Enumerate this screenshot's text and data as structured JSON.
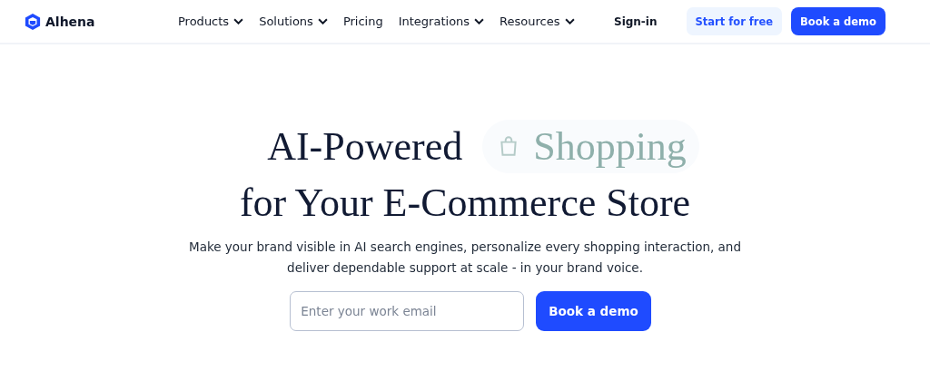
{
  "header": {
    "logo": "Alhena",
    "nav": [
      {
        "label": "Products",
        "has_menu": true
      },
      {
        "label": "Solutions",
        "has_menu": true
      },
      {
        "label": "Pricing",
        "has_menu": false
      },
      {
        "label": "Integrations",
        "has_menu": true
      },
      {
        "label": "Resources",
        "has_menu": true
      }
    ],
    "sign_in": "Sign-in",
    "start_button": "Start for free",
    "demo_button": "Book a demo"
  },
  "hero": {
    "title_start": "AI-Powered",
    "rotating_word": "Shopping",
    "title_end": "for Your E-Commerce Store",
    "subtitle": "Make your brand visible in AI search engines, personalize every shopping interaction, and deliver dependable support at scale - in your brand voice.",
    "email": {
      "placeholder": "Enter your work email"
    },
    "cta_button": "Book a demo"
  }
}
